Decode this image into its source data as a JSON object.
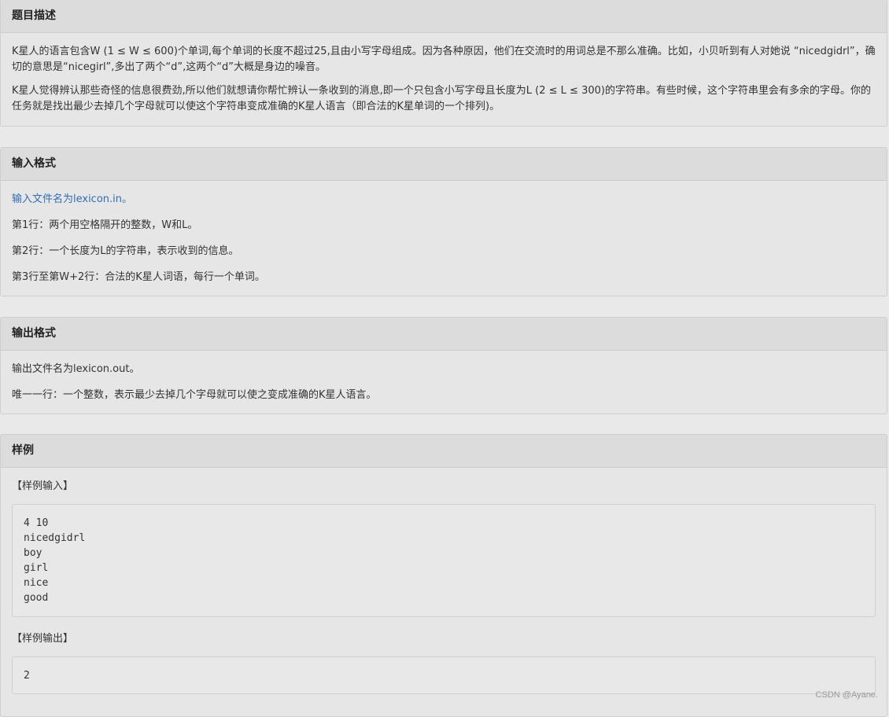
{
  "description": {
    "title": "题目描述",
    "paragraphs": [
      "K星人的语言包含W (1 ≤ W ≤ 600)个单词,每个单词的长度不超过25,且由小写字母组成。因为各种原因，他们在交流时的用词总是不那么准确。比如，小贝听到有人对她说 “nicedgidrl”，确切的意思是“nicegirl”,多出了两个“d”,这两个“d”大概是身边的噪音。",
      "K星人觉得辨认那些奇怪的信息很费劲,所以他们就想请你帮忙辨认一条收到的消息,即一个只包含小写字母且长度为L (2 ≤ L ≤ 300)的字符串。有些时候，这个字符串里会有多余的字母。你的任务就是找出最少去掉几个字母就可以使这个字符串变成准确的K星人语言（即合法的K星单词的一个排列)。"
    ]
  },
  "input_format": {
    "title": "输入格式",
    "file_line": "输入文件名为lexicon.in。",
    "lines": [
      "第1行：两个用空格隔开的整数，W和L。",
      "第2行：一个长度为L的字符串，表示收到的信息。",
      "第3行至第W+2行：合法的K星人词语，每行一个单词。"
    ]
  },
  "output_format": {
    "title": "输出格式",
    "lines": [
      "输出文件名为lexicon.out。",
      "唯一一行：一个整数，表示最少去掉几个字母就可以使之变成准确的K星人语言。"
    ]
  },
  "sample": {
    "title": "样例",
    "input_label": "【样例输入】",
    "input_code": "4 10\nnicedgidrl\nboy\ngirl\nnice\ngood",
    "output_label": "【样例输出】",
    "output_code": "2"
  },
  "watermark": "CSDN @Ayane."
}
